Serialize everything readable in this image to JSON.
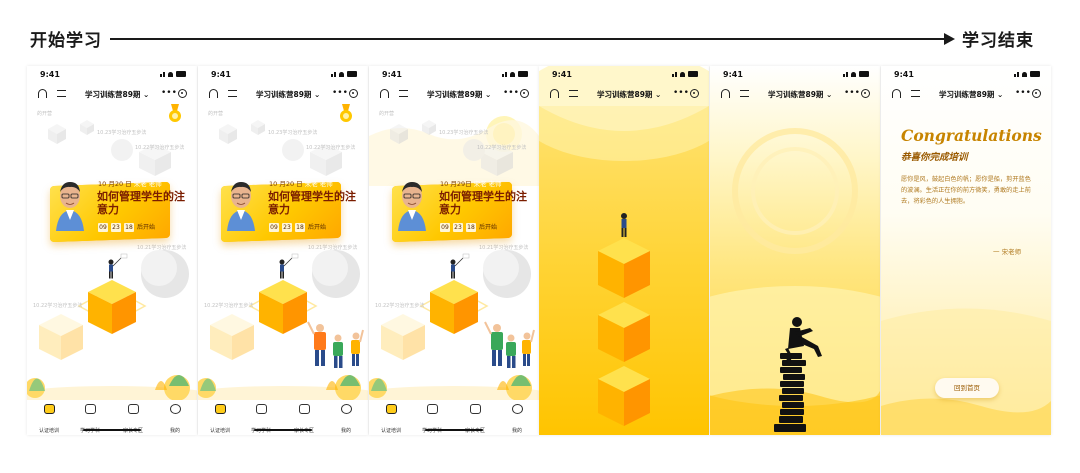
{
  "flow": {
    "start_label": "开始学习",
    "end_label": "学习结束"
  },
  "statusbar": {
    "time": "9:41"
  },
  "navbar": {
    "title": "学习训练营89期 ⌄",
    "more": "•••"
  },
  "course_card": {
    "date_prefix_1": "10 月20 日",
    "date_prefix_3": "10 月29日",
    "teacher_tag": "宋老 老师",
    "title": "如何管理学生的注意力",
    "countdown": [
      "09",
      "23",
      "18"
    ],
    "countdown_suffix": "后开始"
  },
  "floating_labels": {
    "first": "的开营",
    "l1": "10.23学习治疗五步法",
    "l2": "10.22学习治疗五步法",
    "l3": "10.21学习治疗五步法",
    "l4": "10.22学习治疗五步法"
  },
  "tabbar": {
    "items": [
      {
        "label": "认证培训",
        "active": true
      },
      {
        "label": "学习学科",
        "active": false
      },
      {
        "label": "家长专区",
        "active": false
      },
      {
        "label": "我的",
        "active": false
      }
    ]
  },
  "final_screen": {
    "title": "Congratulations",
    "subtitle": "恭喜你完成培训",
    "body": "愿你是风，鼓起白色的帆；愿你是船，剪开蓝色的波澜。生活正在你的前方微笑，勇敢的走上前去，将彩色的人生拥抱。",
    "signature": "一 宋老师",
    "home_button": "回到首页"
  },
  "colors": {
    "accent_yellow": "#ffc800",
    "accent_orange": "#ffa000",
    "title_brown": "#7a1d00",
    "text_gold": "#c78400"
  },
  "icons": [
    "headphone-icon",
    "menu-icon",
    "more-icon",
    "target-icon",
    "medal-icon",
    "graduation-cap-icon",
    "book-icon",
    "family-icon",
    "smile-icon"
  ]
}
